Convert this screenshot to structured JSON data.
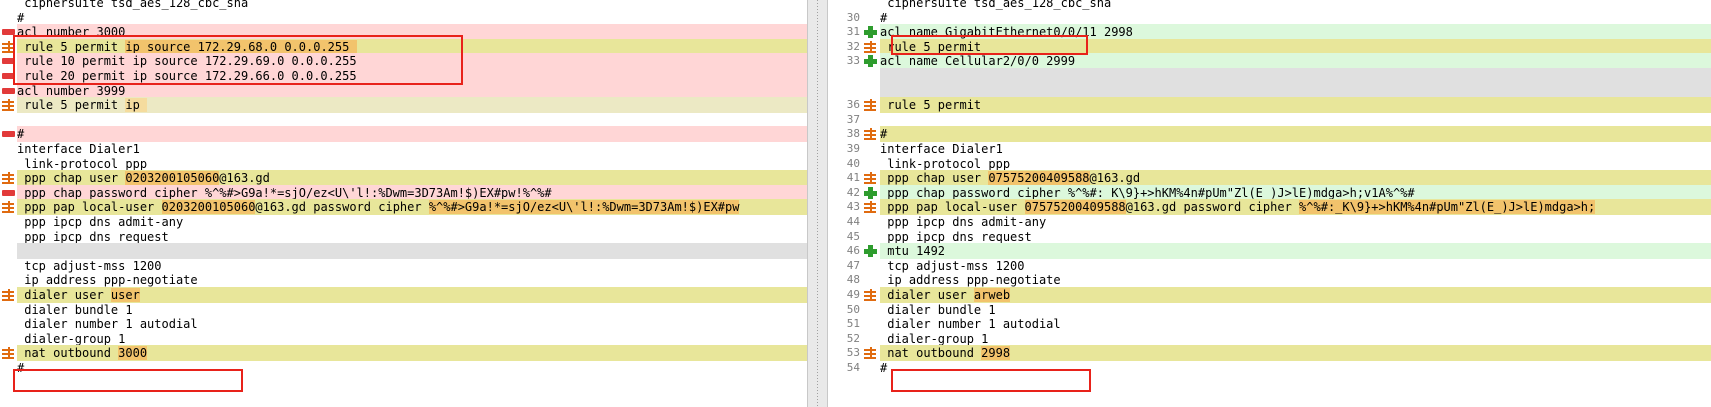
{
  "left_pane": {
    "lines": [
      {
        "type": "plain",
        "segments": [
          " ciphersuite tsd_aes_128_cbc_sha"
        ]
      },
      {
        "type": "plain",
        "segments": [
          "#"
        ]
      },
      {
        "type": "removed",
        "segments": [
          "acl number 3000"
        ]
      },
      {
        "type": "changed",
        "segments": [
          " rule 5 permit ",
          {
            "t": "ip source 172.29.68.0 0.0.0.255 ",
            "hl": true
          }
        ]
      },
      {
        "type": "removed",
        "segments": [
          " rule 10 permit ip source 172.29.69.0 0.0.0.255"
        ]
      },
      {
        "type": "removed",
        "segments": [
          " rule 20 permit ip source 172.29.66.0 0.0.0.255"
        ]
      },
      {
        "type": "removed",
        "segments": [
          "acl number 3999"
        ]
      },
      {
        "type": "changed-light",
        "segments": [
          " rule 5 permit ",
          {
            "t": "ip ",
            "hl": "faint"
          }
        ]
      },
      {
        "type": "empty",
        "segments": []
      },
      {
        "type": "removed",
        "segments": [
          "#"
        ]
      },
      {
        "type": "plain",
        "segments": [
          "interface Dialer1"
        ]
      },
      {
        "type": "plain",
        "segments": [
          " link-protocol ppp"
        ]
      },
      {
        "type": "changed",
        "segments": [
          " ppp chap user ",
          {
            "t": "0203200105060",
            "hl": true
          },
          "@163.gd"
        ]
      },
      {
        "type": "removed",
        "segments": [
          " ppp chap password cipher %^%#>G9a!*=sjO/ez<U\\'l!:%Dwm=3D73Am!$)EX#pw!%^%#"
        ]
      },
      {
        "type": "changed",
        "segments": [
          " ppp pap local-user ",
          {
            "t": "0203200105060",
            "hl": true
          },
          "@163.gd password cipher ",
          {
            "t": "%^%#>G9a!*=sjO/ez<U\\'l!:%Dwm=3D73Am!$)EX#pw",
            "hl": true
          }
        ]
      },
      {
        "type": "plain",
        "segments": [
          " ppp ipcp dns admit-any"
        ]
      },
      {
        "type": "plain",
        "segments": [
          " ppp ipcp dns request"
        ]
      },
      {
        "type": "blank",
        "segments": []
      },
      {
        "type": "plain",
        "segments": [
          " tcp adjust-mss 1200"
        ]
      },
      {
        "type": "plain",
        "segments": [
          " ip address ppp-negotiate"
        ]
      },
      {
        "type": "changed",
        "segments": [
          " dialer user ",
          {
            "t": "user",
            "hl": true
          }
        ]
      },
      {
        "type": "plain",
        "segments": [
          " dialer bundle 1"
        ]
      },
      {
        "type": "plain",
        "segments": [
          " dialer number 1 autodial"
        ]
      },
      {
        "type": "plain",
        "segments": [
          " dialer-group 1"
        ]
      },
      {
        "type": "changed",
        "segments": [
          " nat outbound ",
          {
            "t": "3000",
            "hl": true
          }
        ]
      },
      {
        "type": "plain",
        "segments": [
          "#"
        ]
      }
    ]
  },
  "right_pane": {
    "lines": [
      {
        "num": "",
        "type": "plain",
        "segments": [
          " ciphersuite tsd_aes_128_cbc_sha"
        ]
      },
      {
        "num": "30",
        "type": "plain",
        "segments": [
          "#"
        ]
      },
      {
        "num": "31",
        "type": "added",
        "segments": [
          "acl name GigabitEthernet0/0/11 2998"
        ]
      },
      {
        "num": "32",
        "type": "changed",
        "segments": [
          " rule 5 permit"
        ]
      },
      {
        "num": "33",
        "type": "added",
        "segments": [
          "acl name Cellular2/0/0 2999"
        ]
      },
      {
        "num": "",
        "type": "blank",
        "segments": []
      },
      {
        "num": "",
        "type": "blank",
        "segments": []
      },
      {
        "num": "36",
        "type": "changed",
        "segments": [
          " rule 5 permit"
        ]
      },
      {
        "num": "37",
        "type": "plain",
        "segments": [
          ""
        ]
      },
      {
        "num": "38",
        "type": "changed",
        "segments": [
          "#"
        ]
      },
      {
        "num": "39",
        "type": "plain",
        "segments": [
          "interface Dialer1"
        ]
      },
      {
        "num": "40",
        "type": "plain",
        "segments": [
          " link-protocol ppp"
        ]
      },
      {
        "num": "41",
        "type": "changed",
        "segments": [
          " ppp chap user ",
          {
            "t": "07575200409588",
            "hl": true
          },
          "@163.gd"
        ]
      },
      {
        "num": "42",
        "type": "added",
        "segments": [
          " ppp chap password cipher %^%#:_K\\9}+>hKM%4n#pUm\"Zl(E_)J>lE)mdga>h;v1A%^%#"
        ]
      },
      {
        "num": "43",
        "type": "changed",
        "segments": [
          " ppp pap local-user ",
          {
            "t": "07575200409588",
            "hl": true
          },
          "@163.gd password cipher ",
          {
            "t": "%^%#:_K\\9}+>hKM%4n#pUm\"Zl(E_)J>lE)mdga>h;",
            "hl": true
          }
        ]
      },
      {
        "num": "44",
        "type": "plain",
        "segments": [
          " ppp ipcp dns admit-any"
        ]
      },
      {
        "num": "45",
        "type": "plain",
        "segments": [
          " ppp ipcp dns request"
        ]
      },
      {
        "num": "46",
        "type": "added",
        "segments": [
          " mtu 1492"
        ]
      },
      {
        "num": "47",
        "type": "plain",
        "segments": [
          " tcp adjust-mss 1200"
        ]
      },
      {
        "num": "48",
        "type": "plain",
        "segments": [
          " ip address ppp-negotiate"
        ]
      },
      {
        "num": "49",
        "type": "changed",
        "segments": [
          " dialer user ",
          {
            "t": "arweb",
            "hl": true
          }
        ]
      },
      {
        "num": "50",
        "type": "plain",
        "segments": [
          " dialer bundle 1"
        ]
      },
      {
        "num": "51",
        "type": "plain",
        "segments": [
          " dialer number 1 autodial"
        ]
      },
      {
        "num": "52",
        "type": "plain",
        "segments": [
          " dialer-group 1"
        ]
      },
      {
        "num": "53",
        "type": "changed",
        "segments": [
          " nat outbound ",
          {
            "t": "2998",
            "hl": true
          }
        ]
      },
      {
        "num": "54",
        "type": "plain",
        "segments": [
          "#"
        ]
      }
    ]
  },
  "colors": {
    "removed_bg": "#ffd6d6",
    "changed_bg": "#e8e69a",
    "added_bg": "#dcf8dc",
    "blank_bg": "#e0e0e0",
    "highlight": "#f2c36c",
    "annotation_box": "#e8221a"
  },
  "icons": {
    "removed": "minus-marker-icon",
    "added": "plus-marker-icon",
    "changed": "change-marker-icon"
  }
}
